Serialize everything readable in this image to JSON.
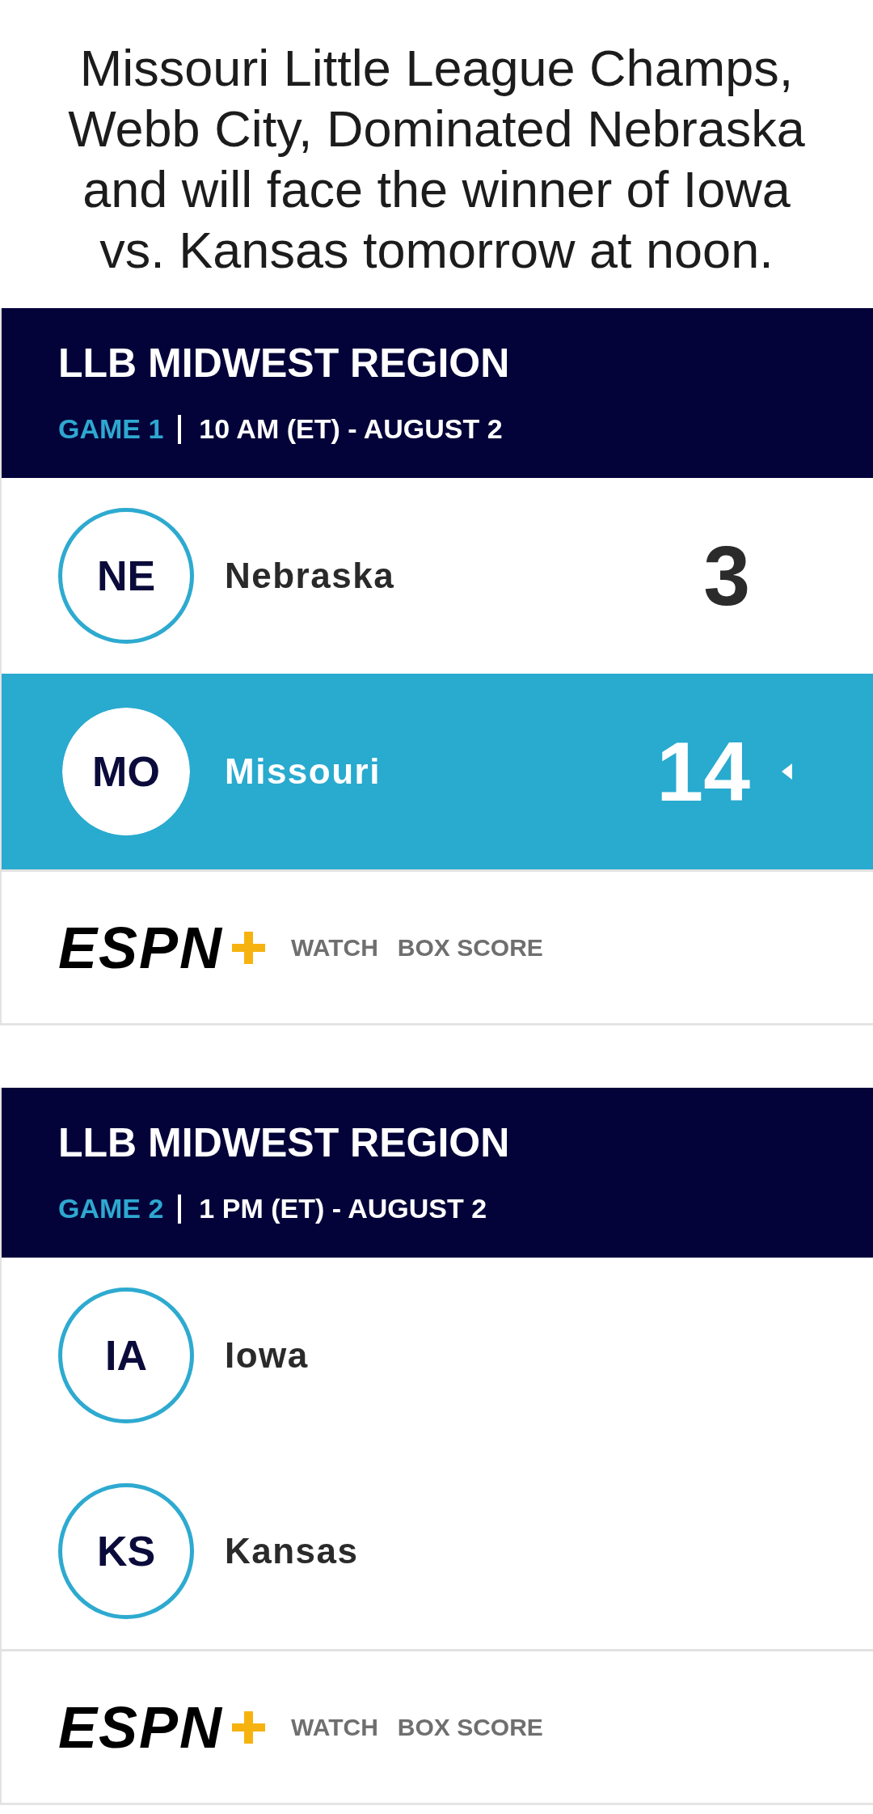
{
  "headline": "Missouri Little League Champs, Webb City, Dominated Nebraska and will face the winner of Iowa vs. Kansas tomorrow at noon.",
  "games": [
    {
      "title": "LLB MIDWEST REGION",
      "game_label": "GAME 1",
      "schedule": "10 AM (ET) - AUGUST 2",
      "teams": [
        {
          "abbr": "NE",
          "name": "Nebraska",
          "score": "3",
          "winner": false
        },
        {
          "abbr": "MO",
          "name": "Missouri",
          "score": "14",
          "winner": true
        }
      ],
      "footer": {
        "logo": "ESPN",
        "links": [
          "WATCH",
          "BOX SCORE"
        ]
      }
    },
    {
      "title": "LLB MIDWEST REGION",
      "game_label": "GAME 2",
      "schedule": "1 PM (ET) - AUGUST 2",
      "teams": [
        {
          "abbr": "IA",
          "name": "Iowa",
          "winner": false
        },
        {
          "abbr": "KS",
          "name": "Kansas",
          "winner": false
        }
      ],
      "footer": {
        "logo": "ESPN",
        "links": [
          "WATCH",
          "BOX SCORE"
        ]
      }
    }
  ]
}
